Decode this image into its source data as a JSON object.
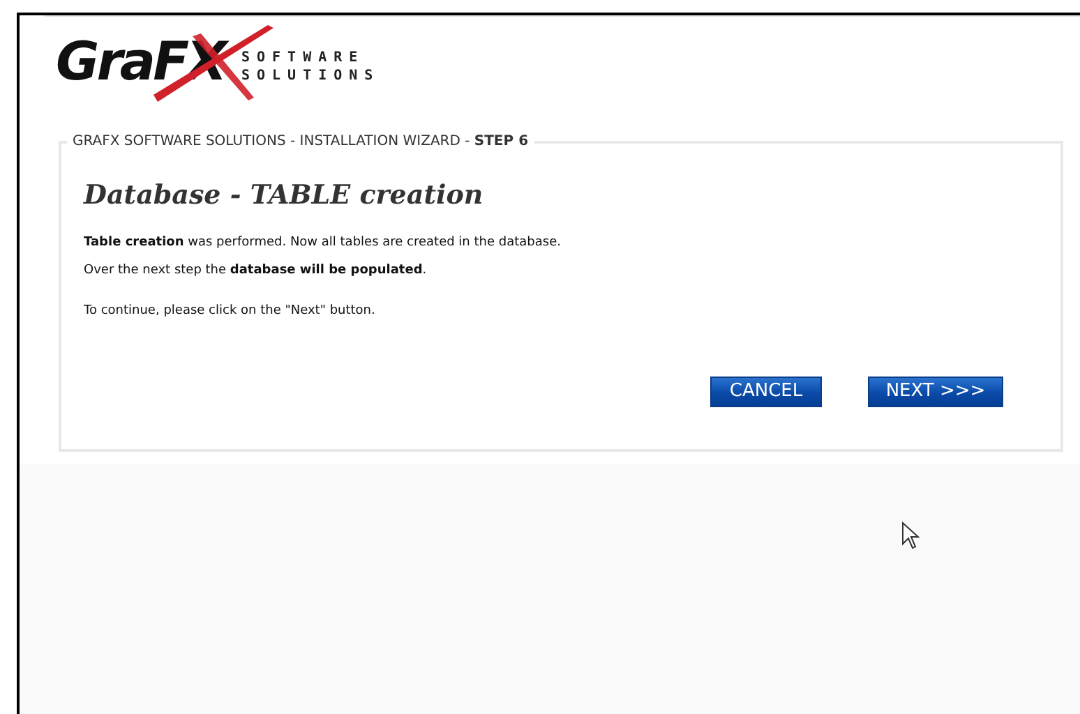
{
  "logo": {
    "wordmark": "GraFX",
    "tagline": [
      "SOFTWARE",
      "SOLUTIONS"
    ]
  },
  "wizard": {
    "legend": "GRAFX SOFTWARE SOLUTIONS - INSTALLATION WIZARD - **STEP 6**",
    "heading": "Database - TABLE creation",
    "paragraphs": [
      "**Table creation** was performed. Now all tables are created in the database.",
      "Over the next step the **database will be populated**.",
      "To continue, please click on the \"Next\" button."
    ],
    "buttons": [
      "CANCEL",
      "NEXT >>>"
    ]
  }
}
